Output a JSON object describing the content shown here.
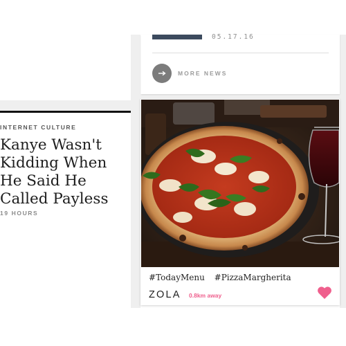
{
  "news": {
    "date": "05.17.16",
    "more_label": "MORE NEWS"
  },
  "article": {
    "kicker": "INTERNET CULTURE",
    "headline": "Kanye Wasn't Kidding When He Said He Called Payless",
    "time": "19 HOURS"
  },
  "post": {
    "tags": [
      "#TodayMenu",
      "#PizzaMargherita"
    ],
    "place": "ZOLA",
    "distance": "0.8km away",
    "icons": [
      "arrow-right-icon",
      "heart-icon"
    ]
  },
  "colors": {
    "accent_pink": "#ef5f8d",
    "rule_black": "#111111",
    "gutter": "#efefef"
  }
}
